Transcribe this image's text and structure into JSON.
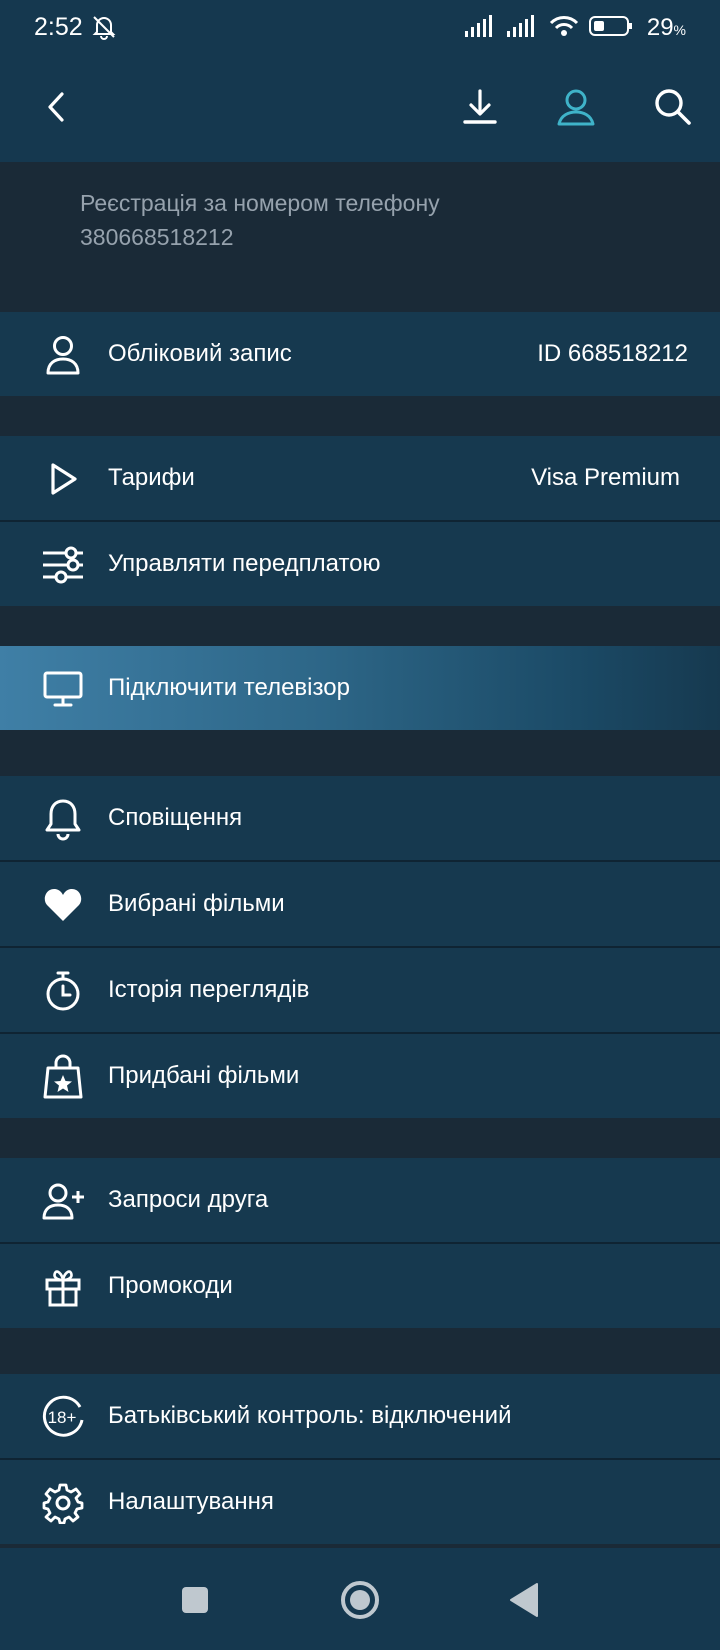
{
  "status": {
    "time": "2:52",
    "battery": "29",
    "battery_unit": "%"
  },
  "header": {
    "back_icon": "chevron-left-icon",
    "download_icon": "download-icon",
    "profile_icon": "user-icon",
    "search_icon": "search-icon",
    "active_color": "#3fb3c9"
  },
  "info": {
    "line1": "Реєстрація за номером телефону",
    "line2": "380668518212"
  },
  "menu": {
    "account": {
      "label": "Обліковий запис",
      "value": "ID 668518212"
    },
    "tariffs": {
      "label": "Тарифи",
      "value": "Visa Premium"
    },
    "subscription": {
      "label": "Управляти передплатою"
    },
    "tv": {
      "label": "Підключити телевізор"
    },
    "notifications": {
      "label": "Сповіщення"
    },
    "favorites": {
      "label": "Вибрані фільми"
    },
    "history": {
      "label": "Історія переглядів"
    },
    "purchased": {
      "label": "Придбані фільми"
    },
    "invite": {
      "label": "Запроси друга"
    },
    "promo": {
      "label": "Промокоди"
    },
    "parental": {
      "label": "Батьківський контроль: відключений",
      "badge": "18+"
    },
    "settings": {
      "label": "Налаштування"
    }
  },
  "colors": {
    "background": "#1a2a37",
    "row": "#16394f",
    "header": "#15384f",
    "muted_text": "#96a2ad"
  }
}
